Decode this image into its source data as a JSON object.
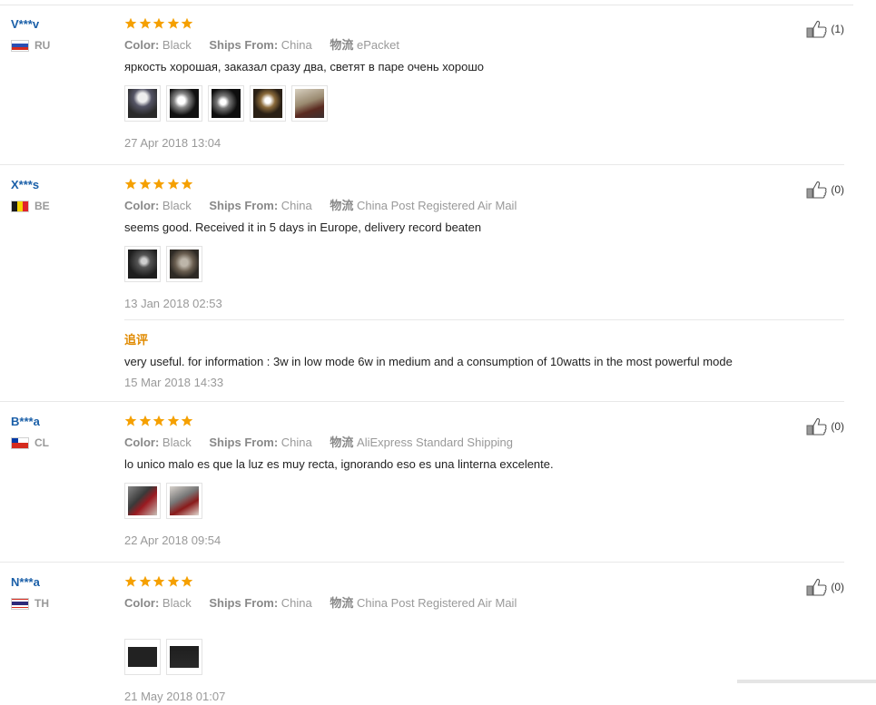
{
  "reviews": [
    {
      "user": "V***v",
      "country": "RU",
      "rating": 5,
      "color_label": "Color:",
      "color": "Black",
      "ships_label": "Ships From:",
      "ships_from": "China",
      "logistics_label": "物流",
      "logistics": "ePacket",
      "text": "яркость хорошая, заказал сразу два, светят в паре очень хорошо",
      "photo_count": 5,
      "date": "27 Apr 2018 13:04",
      "helpful": "(1)"
    },
    {
      "user": "X***s",
      "country": "BE",
      "rating": 5,
      "color_label": "Color:",
      "color": "Black",
      "ships_label": "Ships From:",
      "ships_from": "China",
      "logistics_label": "物流",
      "logistics": "China Post Registered Air Mail",
      "text": "seems good. Received it in 5 days in Europe, delivery record beaten",
      "photo_count": 2,
      "date": "13 Jan 2018 02:53",
      "helpful": "(0)",
      "additional": {
        "title": "追评",
        "text": "very useful. for information : 3w in low mode 6w in medium and a consumption of 10watts in the most powerful mode",
        "date": "15 Mar 2018 14:33"
      }
    },
    {
      "user": "B***a",
      "country": "CL",
      "rating": 5,
      "color_label": "Color:",
      "color": "Black",
      "ships_label": "Ships From:",
      "ships_from": "China",
      "logistics_label": "物流",
      "logistics": "AliExpress Standard Shipping",
      "text": "lo unico malo es que la luz es muy recta, ignorando eso es una linterna excelente.",
      "photo_count": 2,
      "date": "22 Apr 2018 09:54",
      "helpful": "(0)"
    },
    {
      "user": "N***a",
      "country": "TH",
      "rating": 5,
      "color_label": "Color:",
      "color": "Black",
      "ships_label": "Ships From:",
      "ships_from": "China",
      "logistics_label": "物流",
      "logistics": "China Post Registered Air Mail",
      "text": "",
      "photo_count": 2,
      "date": "21 May 2018 01:07",
      "helpful": "(0)"
    }
  ],
  "icons": {
    "star": "star-icon",
    "thumb": "thumbs-up-icon"
  },
  "colors": {
    "star": "#f5a000",
    "username": "#1a5fa8",
    "meta": "#999999",
    "append_title": "#e08a00"
  }
}
